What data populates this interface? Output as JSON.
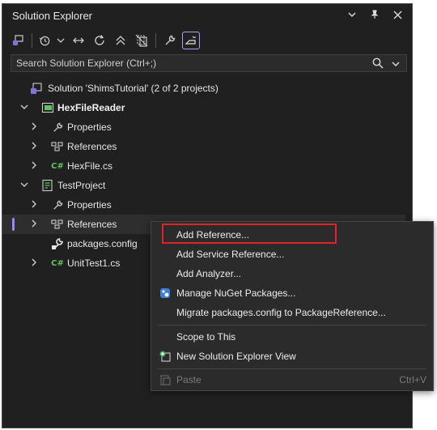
{
  "title": "Solution Explorer",
  "search": {
    "placeholder": "Search Solution Explorer (Ctrl+;)"
  },
  "tree": {
    "solution": "Solution 'ShimsTutorial' (2 of 2 projects)",
    "project1": "HexFileReader",
    "properties1": "Properties",
    "references1": "References",
    "hexfile": "HexFile.cs",
    "project2": "TestProject",
    "properties2": "Properties",
    "references2": "References",
    "packages": "packages.config",
    "unittest": "UnitTest1.cs",
    "cs_badge": "C#",
    "cs_badge_hex": "C#",
    "cs_badge_unit": "C#"
  },
  "context_menu": {
    "add_reference": "Add Reference...",
    "add_service_reference": "Add Service Reference...",
    "add_analyzer": "Add Analyzer...",
    "manage_nuget": "Manage NuGet Packages...",
    "migrate": "Migrate packages.config to PackageReference...",
    "scope": "Scope to This",
    "new_view": "New Solution Explorer View",
    "paste": "Paste",
    "paste_shortcut": "Ctrl+V"
  },
  "colors": {
    "panel_bg": "#202020",
    "accent": "#9b87f5",
    "highlight_box": "#e0222a",
    "csharp": "#5ec55e"
  }
}
